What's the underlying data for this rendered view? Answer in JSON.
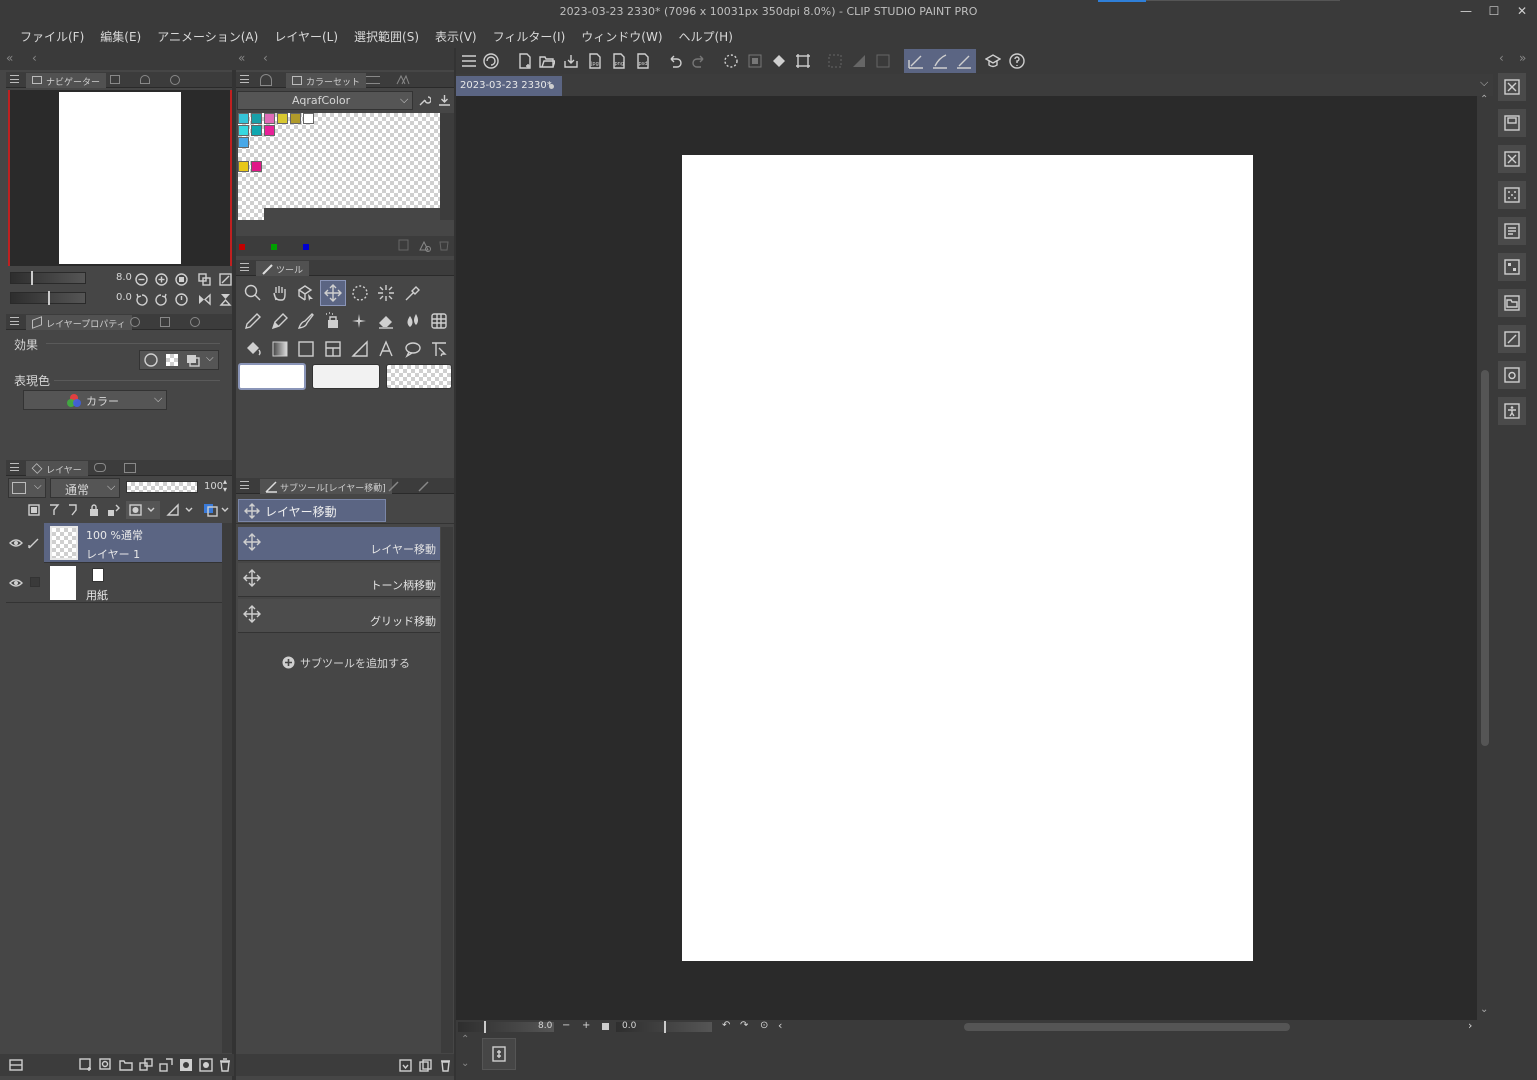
{
  "window": {
    "title": "2023-03-23 2330* (7096 x 10031px 350dpi 8.0%)  - CLIP STUDIO PAINT PRO",
    "controls": [
      "—",
      "☐",
      "✕"
    ]
  },
  "menu": [
    "ファイル(F)",
    "編集(E)",
    "アニメーション(A)",
    "レイヤー(L)",
    "選択範囲(S)",
    "表示(V)",
    "フィルター(I)",
    "ウィンドウ(W)",
    "ヘルプ(H)"
  ],
  "navigator": {
    "tab": "ナビゲーター",
    "zoom": "8.0",
    "rotation": "0.0"
  },
  "color_set": {
    "tab": "カラーセット",
    "set_name": "AqrafColor",
    "swatches": [
      "#35c4d8",
      "#19a0a8",
      "#e06cb8",
      "#d8c830",
      "#b09a2a",
      "#ffffff",
      "#38d8e0",
      "#10a8b0",
      "#e82098",
      "#48a8e8",
      "#e8c818",
      "#e01888"
    ],
    "rgb_markers": [
      "#c00000",
      "#00a000",
      "#0000d0"
    ]
  },
  "tools": {
    "tab": "ツール"
  },
  "layer_property": {
    "tab": "レイヤープロパティ",
    "effect_label": "効果",
    "color_label": "表現色",
    "color_value": "カラー"
  },
  "layers": {
    "tab": "レイヤー",
    "blend_mode": "通常",
    "opacity": "100",
    "items": [
      {
        "line1": "100 %通常",
        "line2": "レイヤー 1"
      },
      {
        "line1": "",
        "line2": "用紙"
      }
    ]
  },
  "subtool": {
    "tab": "サブツール[レイヤー移動]",
    "group": "レイヤー移動",
    "items": [
      "レイヤー移動",
      "トーン柄移動",
      "グリッド移動"
    ],
    "add_label": "サブツールを追加する"
  },
  "canvas": {
    "doc_tab": "2023-03-23 2330*",
    "zoom": "8.0",
    "angle": "0.0"
  }
}
